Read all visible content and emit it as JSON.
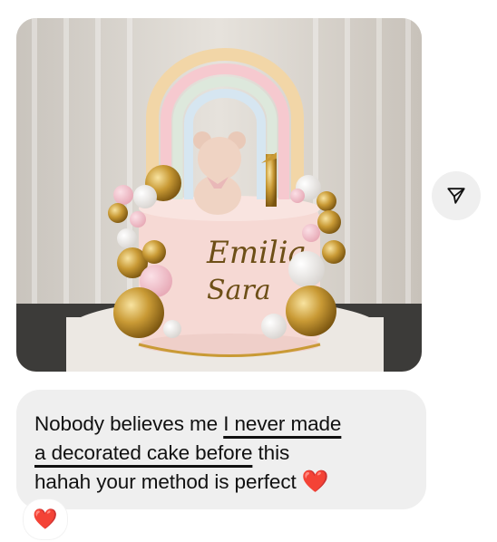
{
  "photo": {
    "alt": "Decorated cake photo",
    "topper_text": [
      "Emilia",
      "Sara"
    ],
    "candle_number": "1"
  },
  "message": {
    "line1_plain": "Nobody believes me ",
    "line1_highlight": "I never made",
    "line2_highlight": "a decorated cake before",
    "line2_plain": " this",
    "line3_plain": "hahah your method is perfect ",
    "heart": "❤️"
  },
  "reaction": {
    "emoji": "❤️"
  },
  "colors": {
    "bubble": "#efefef",
    "heart": "#e8262b",
    "text": "#111111"
  },
  "icons": {
    "share": "send-icon"
  }
}
